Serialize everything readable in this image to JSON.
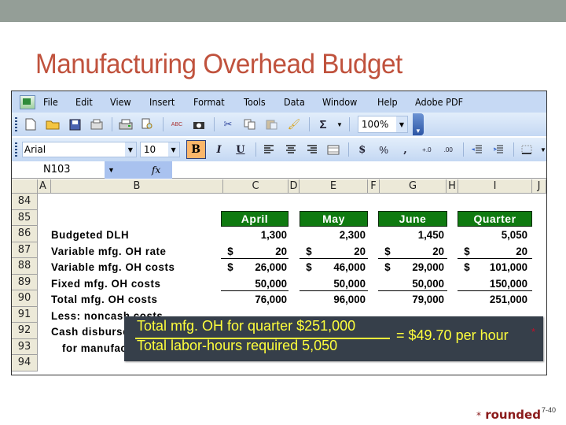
{
  "slide": {
    "title": "Manufacturing Overhead Budget",
    "footnote_asterisk": "*",
    "footnote_text": "rounded",
    "page_number": "7-40"
  },
  "excel": {
    "menu": [
      "File",
      "Edit",
      "View",
      "Insert",
      "Format",
      "Tools",
      "Data",
      "Window",
      "Help",
      "Adobe PDF"
    ],
    "toolbar_standard": {
      "icons": [
        "new-document-icon",
        "open-folder-icon",
        "save-icon",
        "permission-icon",
        "print-icon",
        "print-preview-icon",
        "spelling-icon",
        "camera-icon",
        "cut-icon",
        "copy-icon",
        "paste-icon",
        "format-painter-icon",
        "autosum-icon"
      ],
      "zoom": "100%"
    },
    "toolbar_formatting": {
      "font": "Arial",
      "font_size": "10",
      "bold": "B",
      "italic": "I",
      "underline": "U",
      "currency": "$",
      "percent": "%",
      "comma": ",",
      "increase_decimal": "+.0",
      "decrease_decimal": ".00"
    },
    "name_box": "N103",
    "fx_label": "fx",
    "formula_value": "",
    "columns": [
      "A",
      "B",
      "C",
      "D",
      "E",
      "F",
      "G",
      "H",
      "I",
      "J"
    ],
    "rows": [
      "84",
      "85",
      "86",
      "87",
      "88",
      "89",
      "90",
      "91",
      "92",
      "93",
      "94"
    ],
    "month_headers": [
      "April",
      "May",
      "June",
      "Quarter"
    ],
    "line_items": [
      {
        "label": "Budgeted DLH",
        "values": [
          "1,300",
          "2,300",
          "1,450",
          "5,050"
        ],
        "dollar": false
      },
      {
        "label": "Variable mfg. OH rate",
        "values": [
          "20",
          "20",
          "20",
          "20"
        ],
        "dollar": true
      },
      {
        "label": "Variable mfg. OH costs",
        "values": [
          "26,000",
          "46,000",
          "29,000",
          "101,000"
        ],
        "dollar": true
      },
      {
        "label": "Fixed mfg. OH costs",
        "values": [
          "50,000",
          "50,000",
          "50,000",
          "150,000"
        ],
        "dollar": false
      },
      {
        "label": "Total mfg. OH costs",
        "values": [
          "76,000",
          "96,000",
          "79,000",
          "251,000"
        ],
        "dollar": false
      },
      {
        "label": "Less: noncash costs",
        "values": [],
        "dollar": false
      },
      {
        "label": "Cash disbursements",
        "values": [],
        "dollar": false
      },
      {
        "label": "for manufacturing OH",
        "values": [],
        "dollar": false
      }
    ],
    "dollar_sign": "$"
  },
  "callout": {
    "numerator": "Total mfg. OH for quarter  $251,000",
    "denominator": "Total labor-hours required    5,050",
    "result": "=  $49.70 per hour",
    "asterisk": "*"
  }
}
